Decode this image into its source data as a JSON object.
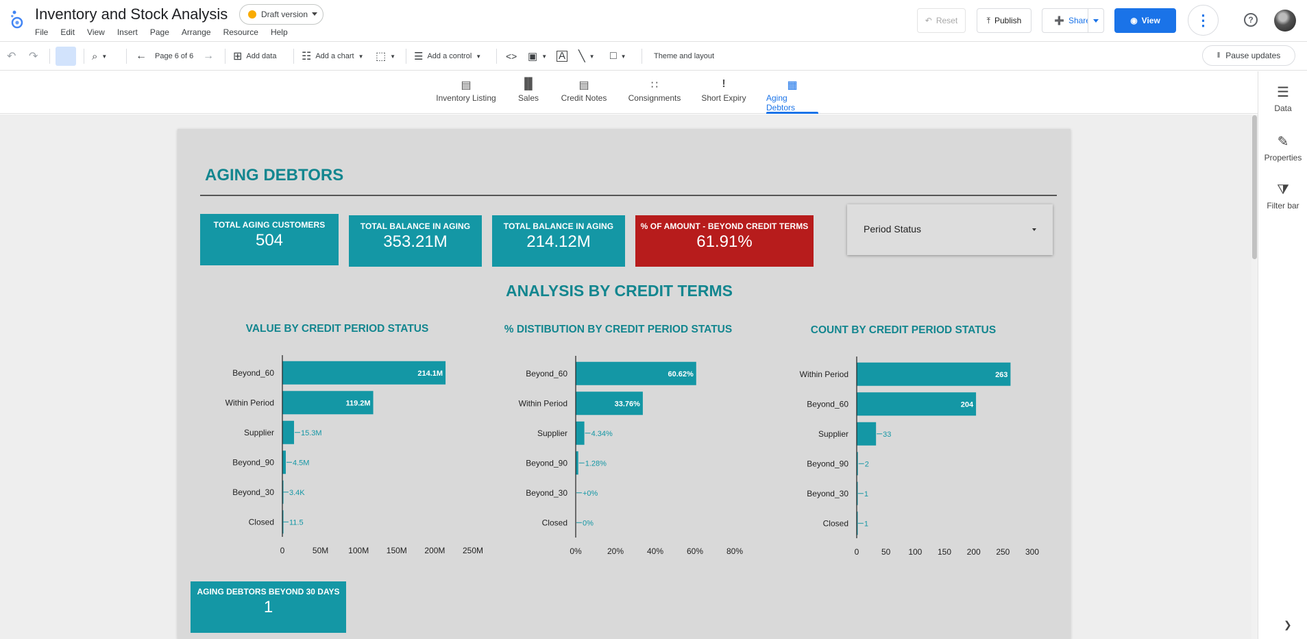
{
  "app": {
    "title": "Inventory and Stock Analysis",
    "draft_label": "Draft version",
    "menu": [
      "File",
      "Edit",
      "View",
      "Insert",
      "Page",
      "Arrange",
      "Resource",
      "Help"
    ],
    "reset_label": "Reset",
    "publish_label": "Publish",
    "share_label": "Share",
    "view_label": "View"
  },
  "toolbar": {
    "page_indicator": "Page 6 of 6",
    "add_data": "Add data",
    "add_chart": "Add a chart",
    "add_control": "Add a control",
    "theme_layout": "Theme and layout",
    "pause_updates": "Pause updates"
  },
  "pages": [
    {
      "label": "Inventory Listing",
      "icon": "bar-chart-icon"
    },
    {
      "label": "Sales",
      "icon": "bars-icon"
    },
    {
      "label": "Credit Notes",
      "icon": "document-icon"
    },
    {
      "label": "Consignments",
      "icon": "grid-icon"
    },
    {
      "label": "Short Expiry",
      "icon": "exclamation-icon"
    },
    {
      "label": "Aging Debtors",
      "icon": "calendar-icon",
      "active": true
    }
  ],
  "rail": {
    "data": "Data",
    "properties": "Properties",
    "filter_bar": "Filter bar"
  },
  "report": {
    "title": "AGING DEBTORS",
    "kpis": [
      {
        "label": "TOTAL AGING CUSTOMERS",
        "value": "504"
      },
      {
        "label": "TOTAL BALANCE IN AGING",
        "value": "353.21M"
      },
      {
        "label": "TOTAL BALANCE IN AGING",
        "value": "214.12M"
      },
      {
        "label": "% OF AMOUNT - BEYOND CREDIT TERMS",
        "value": "61.91%"
      }
    ],
    "control_label": "Period Status",
    "section_title": "ANALYSIS BY CREDIT TERMS",
    "bottom_kpi": {
      "label": "AGING DEBTORS BEYOND 30 DAYS",
      "value": "1"
    }
  },
  "colors": {
    "accent": "#1497a5",
    "title": "#13868f",
    "alert": "#b71c1c",
    "primary": "#1a73e8"
  },
  "chart_data": [
    {
      "type": "bar",
      "orientation": "horizontal",
      "title": "VALUE BY CREDIT PERIOD STATUS",
      "categories": [
        "Beyond_60",
        "Within Period",
        "Supplier",
        "Beyond_90",
        "Beyond_30",
        "Closed"
      ],
      "values": [
        214100000,
        119200000,
        15300000,
        4500000,
        3400,
        11.5
      ],
      "data_labels": [
        "214.1M",
        "119.2M",
        "15.3M",
        "4.5M",
        "3.4K",
        "11.5"
      ],
      "xlim": [
        0,
        250000000
      ],
      "ticks": [
        0,
        50000000,
        100000000,
        150000000,
        200000000,
        250000000
      ],
      "tick_labels": [
        "0",
        "50M",
        "100M",
        "150M",
        "200M",
        "250M"
      ]
    },
    {
      "type": "bar",
      "orientation": "horizontal",
      "title": "% DISTIBUTION BY CREDIT PERIOD STATUS",
      "categories": [
        "Beyond_60",
        "Within Period",
        "Supplier",
        "Beyond_90",
        "Beyond_30",
        "Closed"
      ],
      "values": [
        60.62,
        33.76,
        4.34,
        1.28,
        0,
        0
      ],
      "data_labels": [
        "60.62%",
        "33.76%",
        "4.34%",
        "1.28%",
        "+0%",
        "0%"
      ],
      "xlim": [
        0,
        80
      ],
      "ticks": [
        0,
        20,
        40,
        60,
        80
      ],
      "tick_labels": [
        "0%",
        "20%",
        "40%",
        "60%",
        "80%"
      ]
    },
    {
      "type": "bar",
      "orientation": "horizontal",
      "title": "COUNT BY CREDIT PERIOD STATUS",
      "categories": [
        "Within Period",
        "Beyond_60",
        "Supplier",
        "Beyond_90",
        "Beyond_30",
        "Closed"
      ],
      "values": [
        263,
        204,
        33,
        2,
        1,
        1
      ],
      "data_labels": [
        "263",
        "204",
        "33",
        "2",
        "1",
        "1"
      ],
      "xlim": [
        0,
        300
      ],
      "ticks": [
        0,
        50,
        100,
        150,
        200,
        250,
        300
      ],
      "tick_labels": [
        "0",
        "50",
        "100",
        "150",
        "200",
        "250",
        "300"
      ]
    }
  ]
}
